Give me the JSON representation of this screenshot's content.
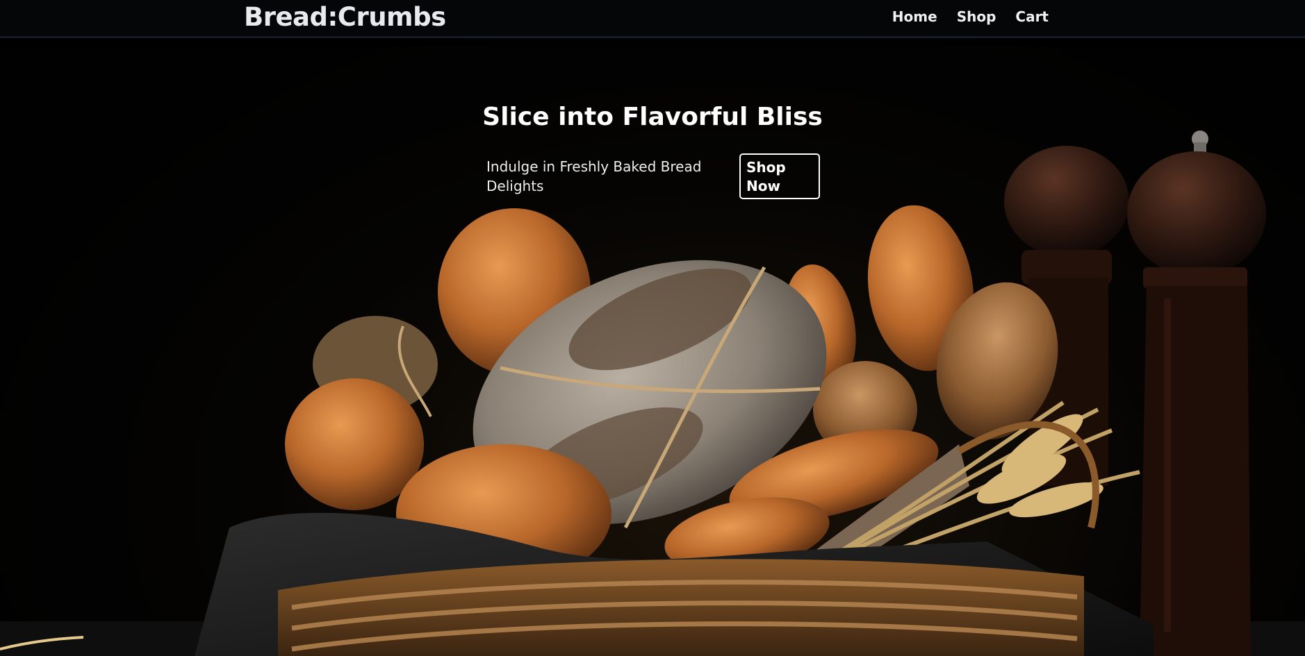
{
  "brand": {
    "name": "Bread:Crumbs"
  },
  "nav": {
    "items": [
      {
        "label": "Home"
      },
      {
        "label": "Shop"
      },
      {
        "label": "Cart"
      }
    ]
  },
  "hero": {
    "title": "Slice into Flavorful Bliss",
    "subtitle": "Indulge in Freshly Baked Bread Delights",
    "cta_label": "Shop Now"
  },
  "colors": {
    "background": "#020202",
    "navbar": "#050608",
    "navbar_border": "#141a26",
    "text": "#ffffff",
    "crust": "#b8672a",
    "basket": "#6a4420"
  }
}
